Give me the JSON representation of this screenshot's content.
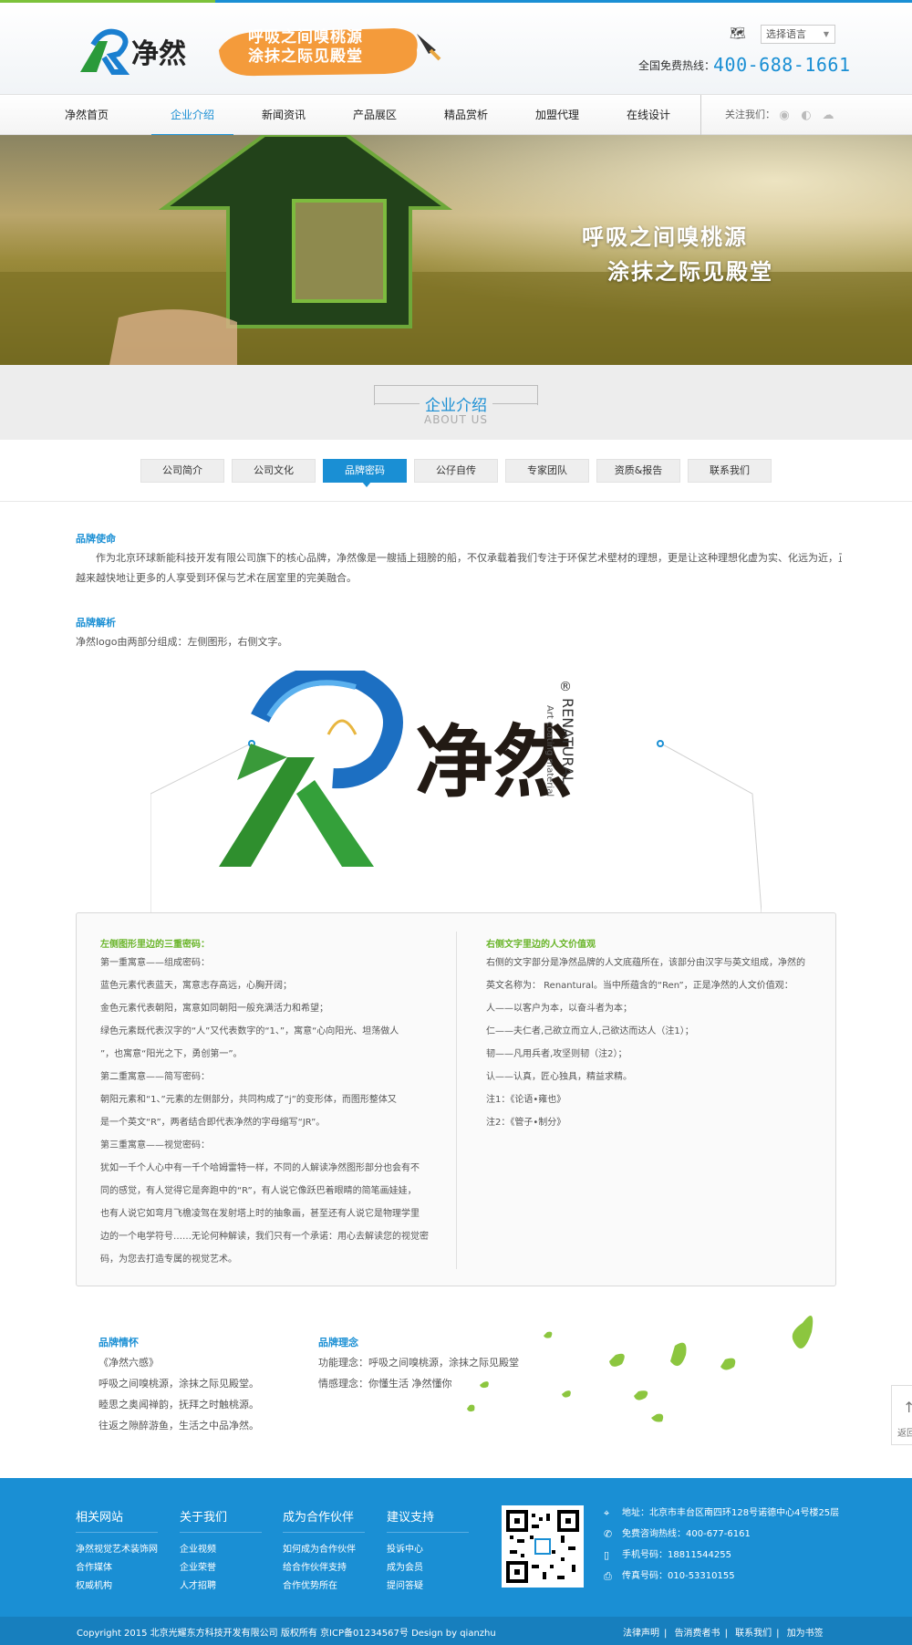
{
  "header": {
    "slogan_line1": "呼吸之间嗅桃源",
    "slogan_line2": "涂抹之际见殿堂",
    "lang_select": "选择语言",
    "hotline_label": "全国免费热线：",
    "hotline": "400-688-1661",
    "logo_text": "净然"
  },
  "nav": {
    "items": [
      {
        "label": "净然首页"
      },
      {
        "label": "企业介绍"
      },
      {
        "label": "新闻资讯"
      },
      {
        "label": "产品展区"
      },
      {
        "label": "精品赏析"
      },
      {
        "label": "加盟代理"
      },
      {
        "label": "在线设计"
      }
    ],
    "active_index": 1,
    "follow_label": "关注我们："
  },
  "hero": {
    "line1": "呼吸之间嗅桃源",
    "line2": "涂抹之际见殿堂"
  },
  "section": {
    "title_cn": "企业介绍",
    "title_en": "ABOUT US"
  },
  "tabs": [
    {
      "label": "公司简介"
    },
    {
      "label": "公司文化"
    },
    {
      "label": "品牌密码"
    },
    {
      "label": "公仔自传"
    },
    {
      "label": "专家团队"
    },
    {
      "label": "资质&报告"
    },
    {
      "label": "联系我们"
    }
  ],
  "content": {
    "mission_title": "品牌使命",
    "mission_line1": "作为北京环球新能科技开发有限公司旗下的核心品牌，净然像是一艘插上翅膀的船，不仅承载着我们专注于环保艺术壁材的理想，更是让这种理想化虚为实、化远为近，正",
    "mission_line2": "越来越快地让更多的人享受到环保与艺术在居室里的完美融合。",
    "analysis_title": "品牌解析",
    "analysis_text": "净然logo由两部分组成：左侧图形，右侧文字。",
    "logo_cn": "净然",
    "logo_en": "RENATURAL",
    "logo_sub": "Art coating material"
  },
  "panel": {
    "left_title": "左侧图形里边的三重密码：",
    "left_lines": [
      "第一重寓意——组成密码：",
      "蓝色元素代表蓝天，寓意志存高远，心胸开阔；",
      "金色元素代表朝阳，寓意如同朝阳一般充满活力和希望；",
      "绿色元素既代表汉字的“人”又代表数字的“1、”，寓意“心向阳光、坦荡做人",
      "”，也寓意“阳光之下，勇创第一”。",
      "第二重寓意——简写密码：",
      "朝阳元素和“1、”元素的左侧部分，共同构成了“j”的变形体，而图形整体又",
      "是一个英文“R”，两者结合即代表净然的字母缩写“JR”。",
      "第三重寓意——视觉密码：",
      "犹如一千个人心中有一千个哈姆雷特一样，不同的人解读净然图形部分也会有不",
      "同的感觉，有人觉得它是奔跑中的“R”，有人说它像跃巴着眼睛的简笔画娃娃，",
      "也有人说它如弯月飞檐凌驾在发射塔上时的抽象画，甚至还有人说它是物理学里",
      "边的一个电学符号……无论何种解读，我们只有一个承诺：用心去解读您的视觉密",
      "码，为您去打造专属的视觉艺术。"
    ],
    "right_title": "右侧文字里边的人文价值观",
    "right_lines": [
      "右侧的文字部分是净然品牌的人文底蕴所在，该部分由汉字与英文组成，净然的",
      "英文名称为：  Renantural。当中所蕴含的“Ren”，正是净然的人文价值观：",
      "人——以客户为本，以奋斗者为本；",
      "仁——夫仁者,己欲立而立人,己欲达而达人（注1）；",
      "韧——凡用兵者,攻坚则韧（注2）；",
      "认——认真，匠心独具，精益求精。",
      "注1：《论语•雍也》",
      "注2：《管子•制分》"
    ]
  },
  "feelings": {
    "title": "品牌情怀",
    "lines": [
      "《净然六感》",
      "呼吸之间嗅桃源，涂抹之际见殿堂。",
      "睦思之奥闻禅韵，抚拜之时触桃源。",
      "往返之隙醉游鱼，生活之中品净然。"
    ]
  },
  "concept": {
    "title": "品牌理念",
    "lines": [
      "功能理念：呼吸之间嗅桃源，涂抹之际见殿堂",
      "情感理念：你懂生活 净然懂你"
    ]
  },
  "sideback": {
    "label": "返回"
  },
  "footer": {
    "cols": [
      {
        "title": "相关网站",
        "links": [
          "净然视觉艺术装饰网",
          "合作媒体",
          "权威机构"
        ]
      },
      {
        "title": "关于我们",
        "links": [
          "企业视频",
          "企业荣誉",
          "人才招聘"
        ]
      },
      {
        "title": "成为合作伙伴",
        "links": [
          "如何成为合作伙伴",
          "给合作伙伴支持",
          "合作优势所在"
        ]
      },
      {
        "title": "建议支持",
        "links": [
          "投诉中心",
          "成为会员",
          "提问答疑"
        ]
      }
    ],
    "contact": {
      "address": "地址：北京市丰台区南四环128号诺德中心4号楼25层",
      "phone": "免费咨询热线：400-677-6161",
      "mobile": "手机号码：18811544255",
      "fax": "传真号码：010-53310155"
    },
    "copyright": "Copyright 2015 北京光耀东方科技开发有限公司 版权所有  京ICP备01234567号  Design by qianzhu",
    "bottom_links": [
      "法律声明",
      "告消费者书",
      "联系我们",
      "加为书签"
    ]
  },
  "colors": {
    "accent": "#1a8fd4",
    "green": "#6ab52a",
    "slogan_orange": "#f49b3b"
  }
}
